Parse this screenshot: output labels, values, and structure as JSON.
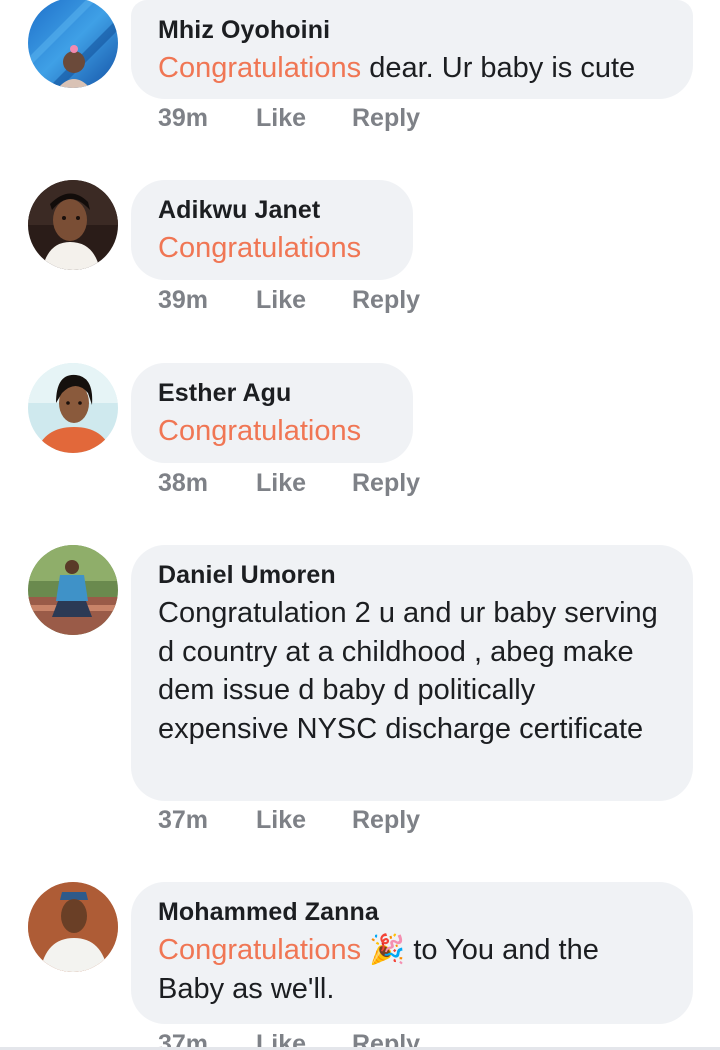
{
  "comments": [
    {
      "author": "Mhiz Oyohoini",
      "highlight": "Congratulations",
      "text": " dear. Ur baby is cute",
      "time": "39m",
      "like": "Like",
      "reply": "Reply",
      "avatar_icon": "profile-photo-icon"
    },
    {
      "author": "Adikwu Janet",
      "highlight": "Congratulations",
      "text": "",
      "time": "39m",
      "like": "Like",
      "reply": "Reply",
      "avatar_icon": "profile-photo-icon"
    },
    {
      "author": "Esther Agu",
      "highlight": "Congratulations",
      "text": "",
      "time": "38m",
      "like": "Like",
      "reply": "Reply",
      "avatar_icon": "profile-photo-icon"
    },
    {
      "author": "Daniel Umoren",
      "highlight": "",
      "text": "Congratulation 2 u and ur baby serving d country at a childhood , abeg make dem issue d baby d politically expensive NYSC discharge certificate",
      "time": "37m",
      "like": "Like",
      "reply": "Reply",
      "avatar_icon": "profile-photo-icon"
    },
    {
      "author": "Mohammed Zanna",
      "highlight": "Congratulations",
      "emoji": "🎉",
      "text": " to You and the Baby as we'll.",
      "time": "37m",
      "like": "Like",
      "reply": "Reply",
      "avatar_icon": "profile-photo-icon"
    }
  ],
  "colors": {
    "highlight": "#f07654",
    "bubble": "#f0f2f5",
    "meta": "#7e8187"
  }
}
